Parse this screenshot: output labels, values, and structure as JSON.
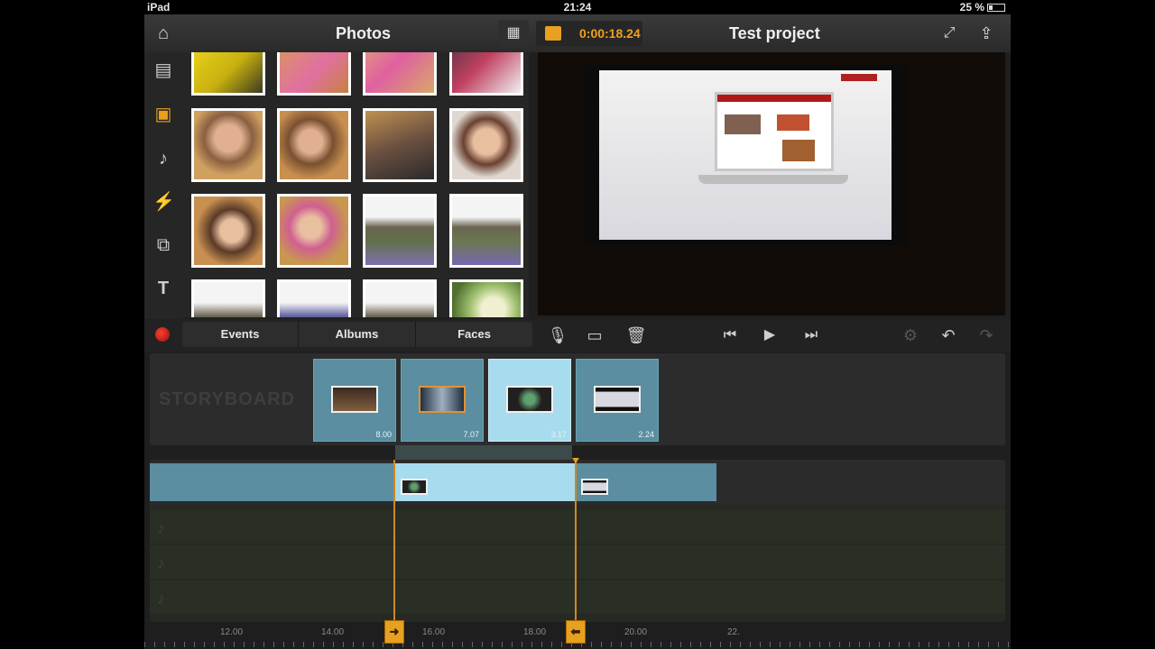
{
  "status_bar": {
    "device": "iPad",
    "time": "21:24",
    "battery": "25 %"
  },
  "header": {
    "left_title": "Photos",
    "timecode": "0:00:18.24",
    "project_title": "Test project"
  },
  "sidebar": {
    "items": [
      {
        "icon": "film-icon"
      },
      {
        "icon": "photo-icon",
        "active": true
      },
      {
        "icon": "music-note-icon"
      },
      {
        "icon": "lightning-icon"
      },
      {
        "icon": "overlay-icon"
      },
      {
        "icon": "text-icon"
      }
    ]
  },
  "toolbar": {
    "tabs": [
      "Events",
      "Albums",
      "Faces"
    ],
    "icons": [
      "record-icon",
      "microphone-icon",
      "split-icon",
      "trash-icon",
      "skip-back-icon",
      "play-icon",
      "skip-forward-icon",
      "settings-icon",
      "undo-icon",
      "redo-icon"
    ]
  },
  "storyboard": {
    "label": "STORYBOARD",
    "clips": [
      {
        "duration": "8.00"
      },
      {
        "duration": "7.07"
      },
      {
        "duration": "3.17",
        "selected": true
      },
      {
        "duration": "2.24"
      }
    ]
  },
  "ruler": {
    "labels": [
      "12.00",
      "14.00",
      "16.00",
      "18.00",
      "20.00",
      "22."
    ]
  },
  "colors": {
    "accent": "#f0a020",
    "clip": "#5a8ea0",
    "clip_selected": "#a6dcee"
  }
}
